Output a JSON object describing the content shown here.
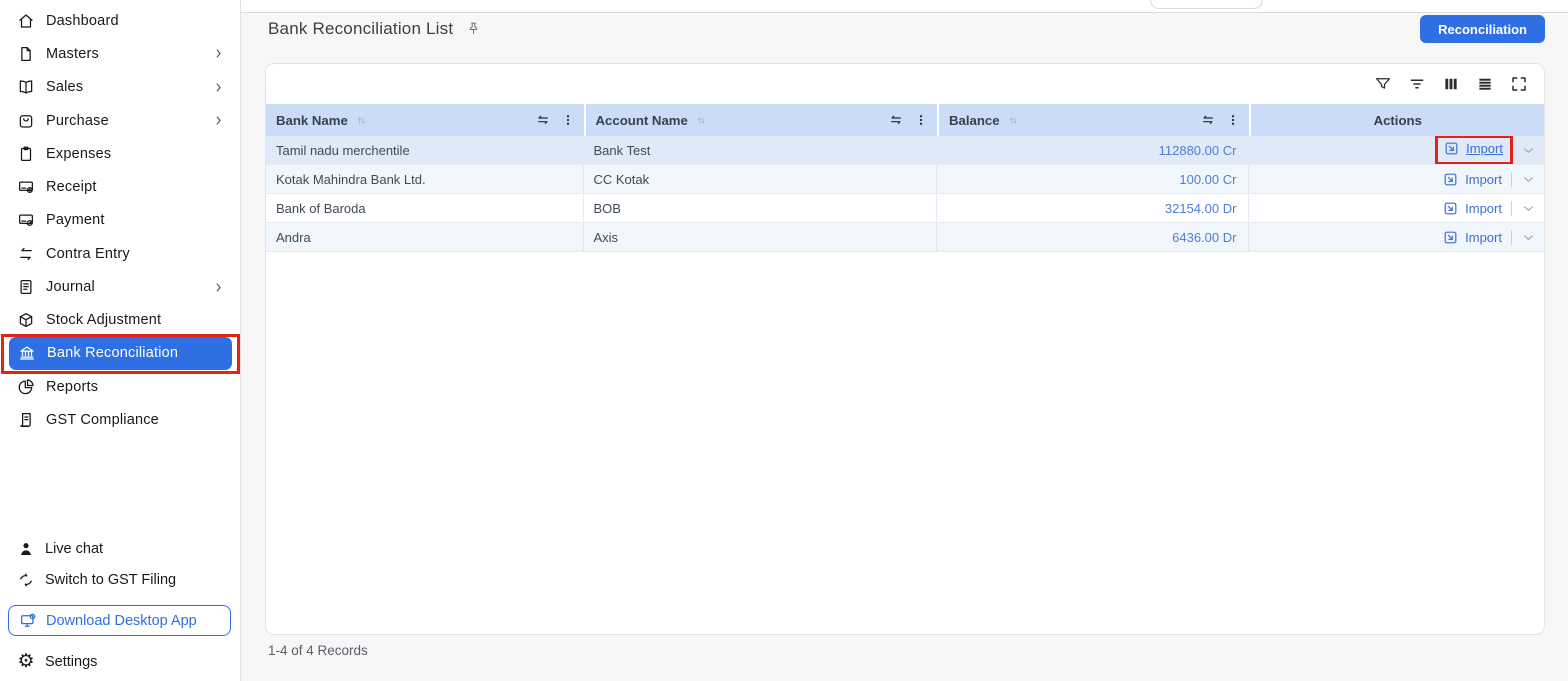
{
  "app": {
    "accent_color": "#2e70e4",
    "annotation_color": "#e0241c"
  },
  "sidebar": {
    "items": [
      {
        "label": "Dashboard",
        "icon": "home-icon",
        "expandable": false,
        "active": false
      },
      {
        "label": "Masters",
        "icon": "file-icon",
        "expandable": true,
        "active": false
      },
      {
        "label": "Sales",
        "icon": "book-icon",
        "expandable": true,
        "active": false
      },
      {
        "label": "Purchase",
        "icon": "shopping-bag-icon",
        "expandable": true,
        "active": false
      },
      {
        "label": "Expenses",
        "icon": "clipboard-icon",
        "expandable": false,
        "active": false
      },
      {
        "label": "Receipt",
        "icon": "card-plus-icon",
        "expandable": false,
        "active": false
      },
      {
        "label": "Payment",
        "icon": "card-minus-icon",
        "expandable": false,
        "active": false
      },
      {
        "label": "Contra Entry",
        "icon": "swap-arrows-icon",
        "expandable": false,
        "active": false
      },
      {
        "label": "Journal",
        "icon": "journal-icon",
        "expandable": true,
        "active": false
      },
      {
        "label": "Stock Adjustment",
        "icon": "box-icon",
        "expandable": false,
        "active": false
      },
      {
        "label": "Bank Reconciliation",
        "icon": "bank-icon",
        "expandable": false,
        "active": true,
        "annotated": true
      },
      {
        "label": "Reports",
        "icon": "pie-chart-icon",
        "expandable": false,
        "active": false
      },
      {
        "label": "GST Compliance",
        "icon": "bill-icon",
        "expandable": false,
        "active": false
      }
    ],
    "footer_items": [
      {
        "label": "Live chat",
        "icon": "person-icon"
      },
      {
        "label": "Switch to GST Filing",
        "icon": "switch-arrows-icon"
      },
      {
        "label": "Download Desktop App",
        "icon": "desktop-download-icon",
        "outlined": true
      },
      {
        "label": "Settings",
        "icon": "gear-icon"
      }
    ]
  },
  "page": {
    "title": "Bank Reconciliation List",
    "title_icon": "pin-icon",
    "primary_button": "Reconciliation"
  },
  "table": {
    "toolbar_icons": [
      "filter-funnel-icon",
      "filter-lines-icon",
      "columns-icon",
      "rows-icon",
      "fullscreen-icon"
    ],
    "columns": [
      {
        "label": "Bank Name",
        "sortable": true
      },
      {
        "label": "Account Name",
        "sortable": true
      },
      {
        "label": "Balance",
        "sortable": true
      },
      {
        "label": "Actions",
        "sortable": false
      }
    ],
    "rows": [
      {
        "bank_name": "Tamil nadu merchentile",
        "account_name": "Bank Test",
        "balance": "112880.00 Cr",
        "action_label": "Import",
        "annotated": true
      },
      {
        "bank_name": "Kotak Mahindra Bank Ltd.",
        "account_name": "CC Kotak",
        "balance": "100.00 Cr",
        "action_label": "Import",
        "annotated": false
      },
      {
        "bank_name": "Bank of Baroda",
        "account_name": "BOB",
        "balance": "32154.00 Dr",
        "action_label": "Import",
        "annotated": false
      },
      {
        "bank_name": "Andra",
        "account_name": "Axis",
        "balance": "6436.00 Dr",
        "action_label": "Import",
        "annotated": false
      }
    ],
    "footer_text": "1-4 of 4 Records"
  },
  "colors": {
    "header_row_bg": "#cadcf8",
    "row_highlight_bg": "#dfe9f8",
    "row_alt_bg": "#f1f6fd",
    "balance_text": "#4d7ed9",
    "link_text": "#3b6fd7"
  }
}
